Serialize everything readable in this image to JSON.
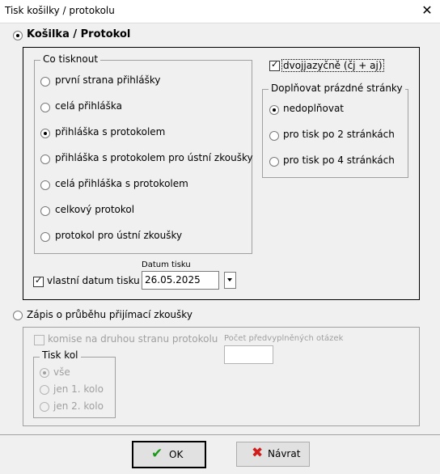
{
  "window": {
    "title": "Tisk košilky / protokolu",
    "close_glyph": "✕"
  },
  "kosilka": {
    "label": "Košilka / Protokol",
    "co_tisknout": {
      "legend": "Co tisknout",
      "options": [
        "první strana přihlášky",
        "celá přihláška",
        "přihláška s protokolem",
        "přihláška s protokolem pro ústní zkoušky",
        "celá přihláška s protokolem",
        "celkový protokol",
        "protokol pro ústní zkoušky"
      ],
      "selected_index": 2
    },
    "dvojjazycne": {
      "label": "dvojjazyčně (čj + aj)",
      "checked": true
    },
    "doplnovat": {
      "legend": "Doplňovat prázdné stránky",
      "options": [
        "nedoplňovat",
        "pro tisk po 2 stránkách",
        "pro tisk po 4 stránkách"
      ],
      "selected_index": 0
    },
    "vlastni_datum": {
      "label": "vlastní datum tisku",
      "checked": true
    },
    "datum_tisku": {
      "label": "Datum tisku",
      "value": "26.05.2025"
    }
  },
  "zapis": {
    "label": "Zápis o průběhu přijímací zkoušky",
    "komise": {
      "label": "komise na druhou stranu protokolu"
    },
    "pocet_otazek": {
      "label": "Počet předvyplněných otázek",
      "value": ""
    },
    "tisk_kol": {
      "legend": "Tisk kol",
      "options": [
        "vše",
        "jen 1. kolo",
        "jen 2. kolo"
      ],
      "selected_index": 0
    }
  },
  "buttons": {
    "ok": "OK",
    "cancel": "Návrat"
  },
  "colors": {
    "ok_check": "#1a9a1a",
    "cancel_x": "#d01c1c"
  }
}
